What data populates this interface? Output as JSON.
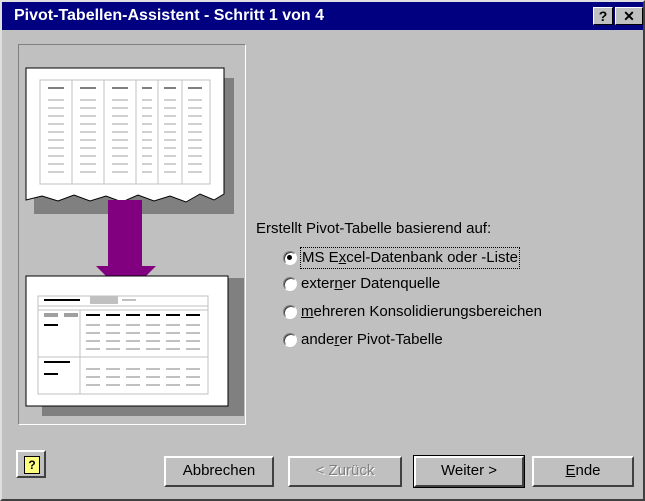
{
  "window": {
    "title": "Pivot-Tabellen-Assistent - Schritt 1 von 4",
    "help_glyph": "?",
    "close_glyph": "✕"
  },
  "section": {
    "label": "Erstellt Pivot-Tabelle basierend auf:"
  },
  "options": [
    {
      "pre": "MS E",
      "key": "x",
      "post": "cel-Datenbank oder -Liste",
      "selected": true
    },
    {
      "pre": "exter",
      "key": "n",
      "post": "er Datenquelle",
      "selected": false
    },
    {
      "pre": "",
      "key": "m",
      "post": "ehreren Konsolidierungsbereichen",
      "selected": false
    },
    {
      "pre": "ande",
      "key": "r",
      "post": "er Pivot-Tabelle",
      "selected": false
    }
  ],
  "buttons": {
    "cancel": "Abbrechen",
    "back": "< Zurück",
    "next": "Weiter >",
    "finish_key": "E",
    "finish_rest": "nde"
  },
  "colors": {
    "titlebar": "#000080",
    "arrow": "#800080",
    "face": "#c0c0c0"
  },
  "icons": {
    "help": "help-icon",
    "arrow": "down-arrow-icon"
  }
}
